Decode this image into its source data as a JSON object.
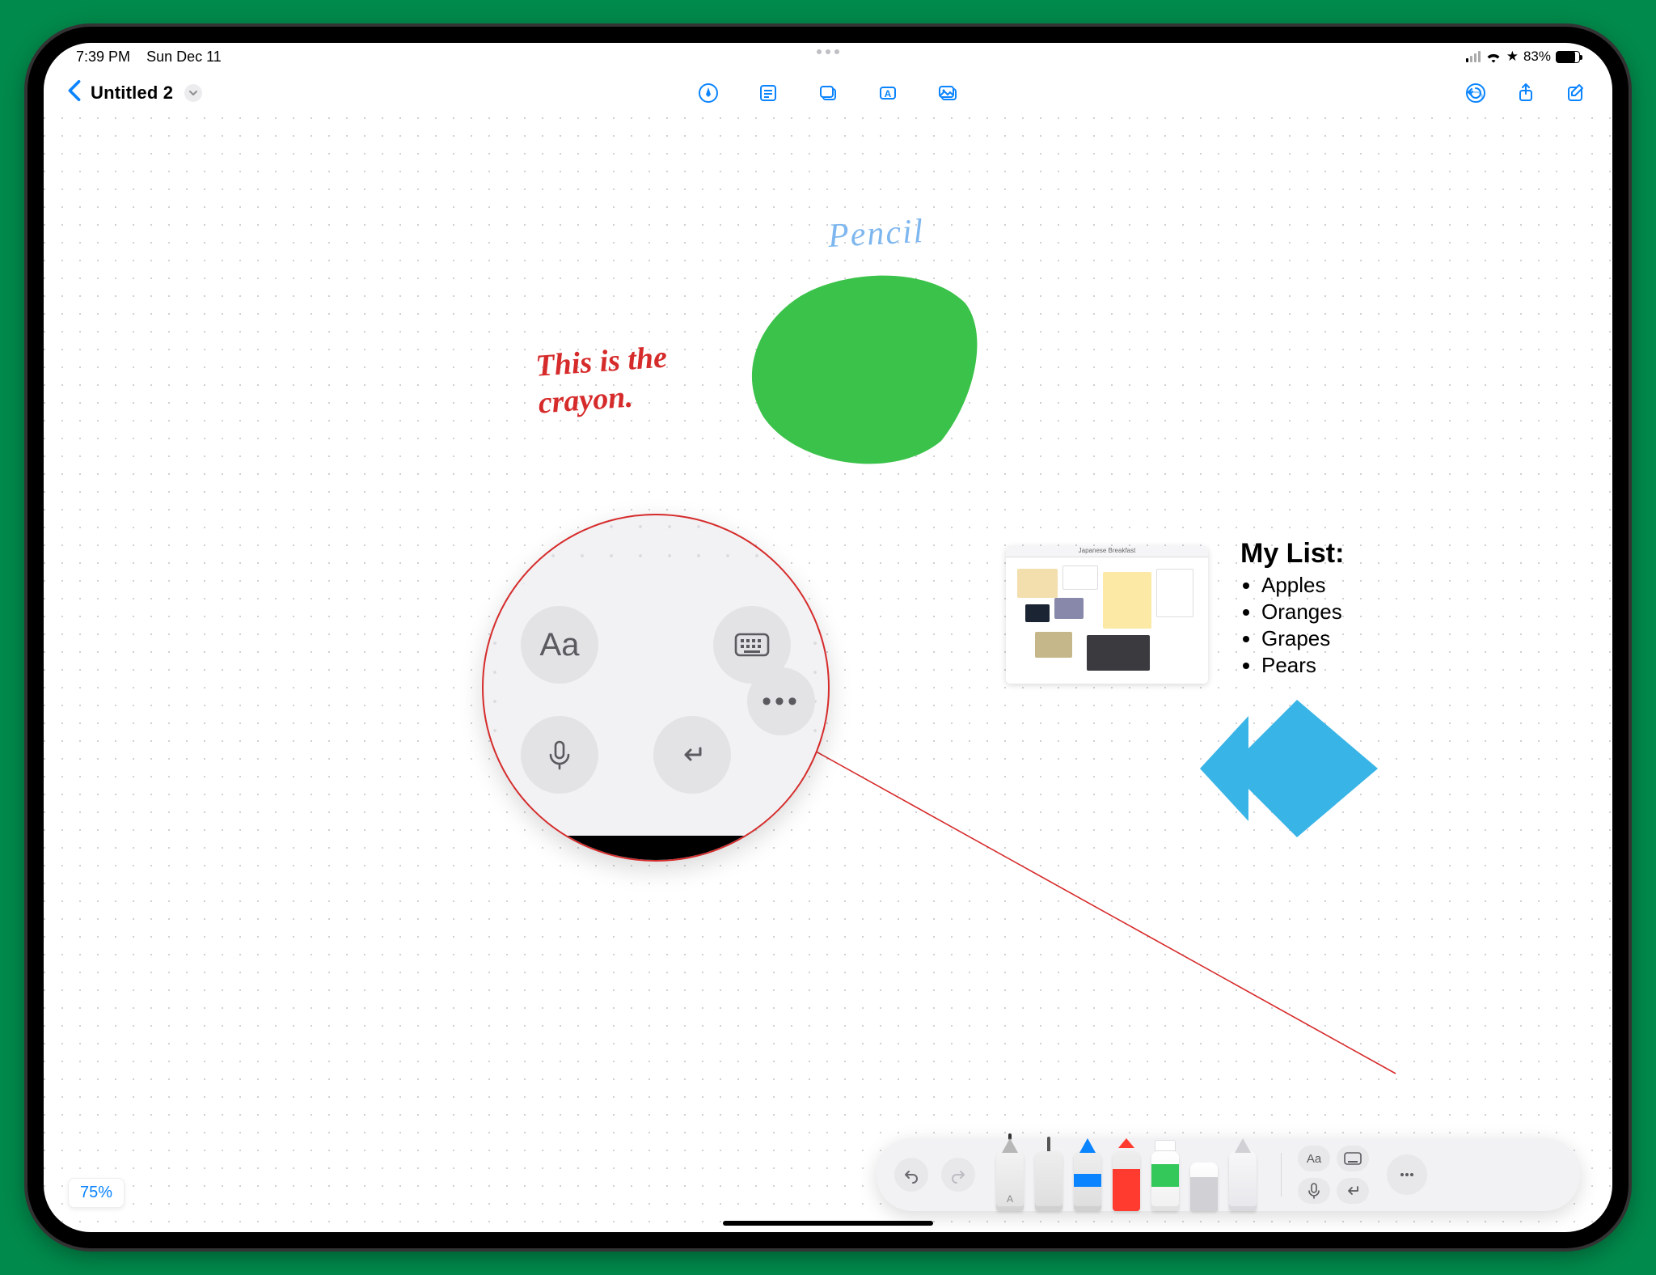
{
  "status": {
    "time": "7:39 PM",
    "date": "Sun Dec 11",
    "battery": "83%"
  },
  "header": {
    "title": "Untitled 2"
  },
  "handwriting": {
    "red_line1": "This is the",
    "red_line2": "crayon.",
    "blue": "Pencil"
  },
  "note": {
    "title": "My List:",
    "items": [
      "Apples",
      "Oranges",
      "Grapes",
      "Pears"
    ]
  },
  "thumbnail": {
    "title": "Japanese Breakfast"
  },
  "magnifier": {
    "font_btn": "Aa",
    "more": "•••"
  },
  "minipad": {
    "font_btn": "Aa"
  },
  "zoom": {
    "value": "75%"
  },
  "colors": {
    "accent": "#0a84ff",
    "green_blob": "#3ac24a",
    "blue_shape": "#39b4e6",
    "crayon_red": "#d62b2b",
    "pencil_blue": "#7eb7ef"
  }
}
